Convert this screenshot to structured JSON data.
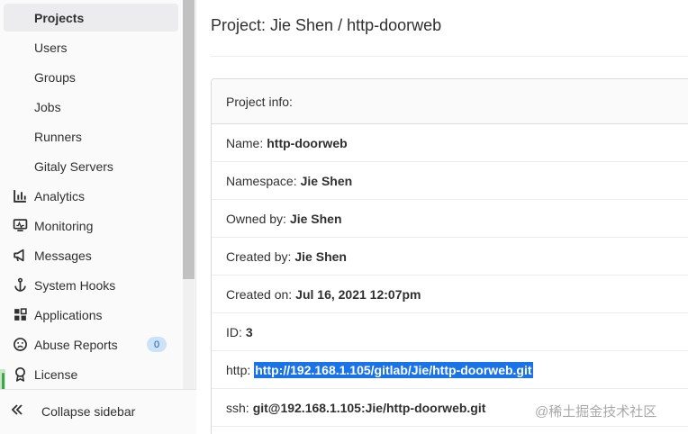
{
  "sidebar": {
    "items": [
      {
        "label": "Projects",
        "icon": "none",
        "active": true
      },
      {
        "label": "Users",
        "icon": "none"
      },
      {
        "label": "Groups",
        "icon": "none"
      },
      {
        "label": "Jobs",
        "icon": "none"
      },
      {
        "label": "Runners",
        "icon": "none"
      },
      {
        "label": "Gitaly Servers",
        "icon": "none"
      },
      {
        "label": "Analytics",
        "icon": "chart-icon"
      },
      {
        "label": "Monitoring",
        "icon": "monitor-icon"
      },
      {
        "label": "Messages",
        "icon": "megaphone-icon"
      },
      {
        "label": "System Hooks",
        "icon": "anchor-icon"
      },
      {
        "label": "Applications",
        "icon": "grid-icon"
      },
      {
        "label": "Abuse Reports",
        "icon": "face-icon",
        "badge": "0"
      },
      {
        "label": "License",
        "icon": "ribbon-icon"
      }
    ],
    "collapse_label": "Collapse sidebar",
    "collapse_icon": "double-chevron-left-icon"
  },
  "main": {
    "title": "Project: Jie Shen / http-doorweb",
    "card_header": "Project info:",
    "rows": {
      "name": {
        "label": "Name:",
        "value": "http-doorweb"
      },
      "namespace": {
        "label": "Namespace:",
        "value": "Jie Shen"
      },
      "owned_by": {
        "label": "Owned by:",
        "value": "Jie Shen"
      },
      "created_by": {
        "label": "Created by:",
        "value": "Jie Shen"
      },
      "created_on": {
        "label": "Created on:",
        "value": "Jul 16, 2021 12:07pm"
      },
      "id": {
        "label": "ID:",
        "value": "3"
      },
      "http": {
        "label": "http:",
        "value": "http://192.168.1.105/gitlab/Jie/http-doorweb.git"
      },
      "ssh": {
        "label": "ssh:",
        "value": "git@192.168.1.105:Jie/http-doorweb.git"
      }
    }
  },
  "watermark": "@稀土掘金技术社区",
  "colors": {
    "highlight": "#1a73e8",
    "badge_bg": "#cbe2f9",
    "active_bg": "#ececef"
  }
}
